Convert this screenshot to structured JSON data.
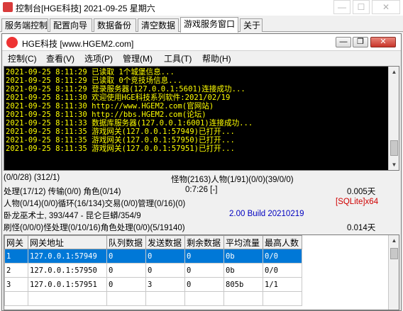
{
  "window": {
    "title": "控制台[HGE科技]  2021-09-25 星期六",
    "min_glyph": "—",
    "max_glyph": "☐",
    "close_glyph": "✕"
  },
  "tabs": [
    "服务端控制",
    "配置向导",
    "数据备份",
    "清空数据",
    "游戏服务窗口",
    "关于"
  ],
  "inner": {
    "title": "HGE科技 [www.HGEM2.com]",
    "min_glyph": "—",
    "max_glyph": "❐",
    "close_glyph": "✕"
  },
  "menu": [
    "控制(C)",
    "查看(V)",
    "选项(P)",
    "管理(M)",
    "工具(T)",
    "帮助(H)"
  ],
  "log": [
    "2021-09-25 8:11:29 已读取 1个城堡信息...",
    "2021-09-25 8:11:29 已读取 0个竞技场信息...",
    "2021-09-25 8:11:29 登录服务器(127.0.0.1:5601)连接成功...",
    "2021-09-25 8:11:30 欢迎使用HGE科技系列软件:2021/02/19",
    "2021-09-25 8:11:30 http://www.HGEM2.com(官网站)",
    "2021-09-25 8:11:30 http://bbs.HGEM2.com(论坛)",
    "2021-09-25 8:11:33 数据库服务器(127.0.0.1:6001)连接成功...",
    "2021-09-25 8:11:35 游戏网关(127.0.0.1:57949)已打开...",
    "2021-09-25 8:11:35 游戏网关(127.0.0.1:57950)已打开...",
    "2021-09-25 8:11:35 游戏网关(127.0.0.1:57951)已打开..."
  ],
  "status": {
    "r1_left": "(0/0/28) (312/1)",
    "r1_right": "怪物(2163)人物(1/91)(0/0)(39/0/0)",
    "r2_left": "处理(17/12) 传输(0/0) 角色(0/14)",
    "r2_mid": "0:7:26 [-]",
    "r2_right": "0.005天",
    "r3_left": "人物(0/14)(0/0)循环(16/134)交易(0/0)管理(0/16)(0)",
    "r3_right": "[SQLite]x64",
    "r4_left": "卧龙巫术士, 393/447 - 昆仑巨蟒/354/9",
    "r4_right": "2.00 Build 20210219",
    "r5_left": "刷怪(0/0/0)怪处理(0/10/16)角色处理(0/0)(5/19140)",
    "r5_right": "0.014天"
  },
  "gateway_table": {
    "headers": [
      "网关",
      "网关地址",
      "队列数据",
      "发送数据",
      "剩余数据",
      "平均流量",
      "最高人数"
    ],
    "rows": [
      [
        "1",
        "127.0.0.1:57949",
        "0",
        "0",
        "0",
        "0b",
        "0/0"
      ],
      [
        "2",
        "127.0.0.1:57950",
        "0",
        "0",
        "0",
        "0b",
        "0/0"
      ],
      [
        "3",
        "127.0.0.1:57951",
        "0",
        "3",
        "0",
        "805b",
        "1/1"
      ]
    ],
    "selected_row": 0
  },
  "colors": {
    "log_bg": "#000000",
    "log_text": "#ffff00",
    "selection": "#0078d7",
    "sqlite_label": "#d00000",
    "build_label": "#0000c0"
  }
}
